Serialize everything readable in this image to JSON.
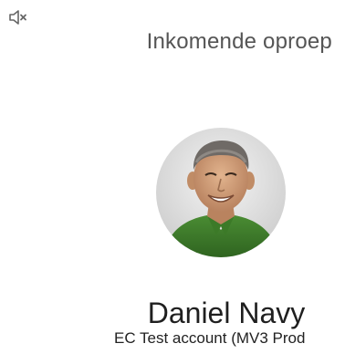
{
  "mute_icon": "volume-muted-icon",
  "call": {
    "title": "Inkomende oproep"
  },
  "caller": {
    "avatar_icon": "caller-photo",
    "name": "Daniel Navy",
    "account": "EC Test account (MV3 Prod"
  },
  "colors": {
    "title": "#555555",
    "name": "#1f1f1f",
    "shirt": "#3f7d2c"
  }
}
